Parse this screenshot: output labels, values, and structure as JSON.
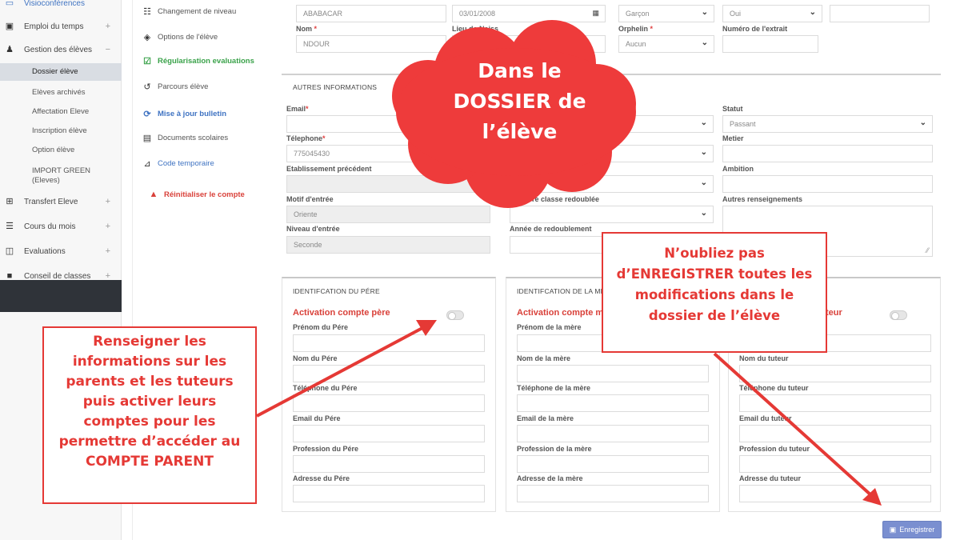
{
  "sidebar": {
    "top_item": "Visioconférences",
    "emploi": "Emploi du temps",
    "gestion": "Gestion des élèves",
    "sub_items": [
      "Dossier élève",
      "Elèves archivés",
      "Affectation Eleve",
      "Inscription élève",
      "Option élève"
    ],
    "import_line1": "IMPORT GREEN",
    "import_line2": "(Eleves)",
    "transfert": "Transfert Eleve",
    "cours": "Cours du mois",
    "evaluations": "Evaluations",
    "conseil": "Conseil de classes",
    "plus": "+",
    "minus": "−"
  },
  "menu2": {
    "items": [
      {
        "label": "Changement de niveau",
        "icon": "list-icon"
      },
      {
        "label": "Options de l'élève",
        "icon": "cube-icon"
      },
      {
        "label": "Régularisation evaluations",
        "icon": "check-square-icon"
      },
      {
        "label": "Parcours élève",
        "icon": "history-icon"
      },
      {
        "label": "Mise à jour bulletin",
        "icon": "refresh-icon"
      },
      {
        "label": "Documents scolaires",
        "icon": "file-icon"
      },
      {
        "label": "Code temporaire",
        "icon": "unlock-icon"
      },
      {
        "label": "Réinitialiser le compte",
        "icon": "lock-icon"
      }
    ]
  },
  "student": {
    "prenom_value": "ABABACAR",
    "date_value": "03/01/2008",
    "sexe_value": "Garçon",
    "extrait_value": "Oui",
    "nom_label": "Nom",
    "nom_value": "NDOUR",
    "lieu_label": "Lieu de Naiss",
    "orphelin_label": "Orphelin",
    "orphelin_value": "Aucun",
    "numero_label": "Numéro de l'extrait",
    "req": "*"
  },
  "autres": {
    "title": "AUTRES INFORMATIONS",
    "email_label": "Email",
    "statut_label": "Statut",
    "statut_value": "Passant",
    "telephone_label": "Télephone",
    "telephone_value": "775045430",
    "metier_label": "Metier",
    "etab_label": "Etablissement précédent",
    "ambition_label": "Ambition",
    "motif_label": "Motif d'entrée",
    "motif_value": "Oriente",
    "derniere_label": "Dernière classe redoublée",
    "autres_label": "Autres renseignements",
    "niveau_label": "Niveau d'entrée",
    "niveau_value": "Seconde",
    "annee_label": "Année de redoublement"
  },
  "pere": {
    "title": "IDENTIFCATION DU PÉRE",
    "activation": "Activation compte père",
    "fields": [
      "Prénom du Pére",
      "Nom du Pére",
      "Téléphone du Pére",
      "Email du Pére",
      "Profession du Pére",
      "Adresse du Pére"
    ]
  },
  "mere": {
    "title": "IDENTIFCATION DE LA MÈ",
    "activation": "Activation compte m",
    "fields": [
      "Prénom de la mère",
      "Nom de la mère",
      "Téléphone de la mère",
      "Email de la mère",
      "Profession de la mère",
      "Adresse de la mère"
    ]
  },
  "tuteur": {
    "activation": "teur",
    "fields": [
      "Nom du tuteur",
      "Téléphone du tuteur",
      "Email du tuteur",
      "Profession du tuteur",
      "Adresse du tuteur"
    ]
  },
  "save_button": "Enregistrer",
  "annotations": {
    "cloud_lines": [
      "Dans le",
      "DOSSIER de",
      "l’élève"
    ],
    "left_callout": [
      "Renseigner les",
      "informations sur les",
      "parents et les tuteurs",
      "puis activer leurs",
      "comptes pour les",
      "permettre d’accéder au",
      "COMPTE PARENT"
    ],
    "right_callout": [
      "N’oubliez pas",
      "d’ENREGISTRER toutes les",
      "modifications dans le",
      "dossier de l’élève"
    ],
    "accent_color": "#e53935"
  }
}
